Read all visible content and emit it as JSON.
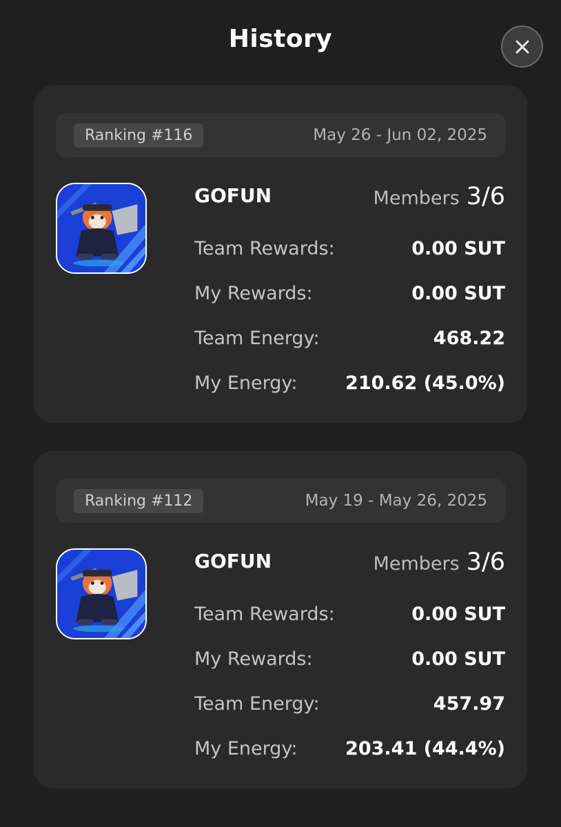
{
  "header": {
    "title": "History",
    "close_icon": "close-icon"
  },
  "colors": {
    "background": "#1f1f1f",
    "card": "#2a2a2a",
    "avatar_blue": "#1a3fd6"
  },
  "history": [
    {
      "ranking": "Ranking #116",
      "date_range": "May 26 - Jun 02, 2025",
      "avatar_icon": "fox-samurai-avatar",
      "team_name": "GOFUN",
      "members_label": "Members",
      "members_value": "3/6",
      "stats": [
        {
          "label": "Team Rewards:",
          "value": "0.00 SUT"
        },
        {
          "label": "My Rewards:",
          "value": "0.00 SUT"
        },
        {
          "label": "Team Energy:",
          "value": "468.22"
        },
        {
          "label": "My Energy:",
          "value": "210.62 (45.0%)"
        }
      ]
    },
    {
      "ranking": "Ranking #112",
      "date_range": "May 19 - May 26, 2025",
      "avatar_icon": "fox-samurai-avatar",
      "team_name": "GOFUN",
      "members_label": "Members",
      "members_value": "3/6",
      "stats": [
        {
          "label": "Team Rewards:",
          "value": "0.00 SUT"
        },
        {
          "label": "My Rewards:",
          "value": "0.00 SUT"
        },
        {
          "label": "Team Energy:",
          "value": "457.97"
        },
        {
          "label": "My Energy:",
          "value": "203.41 (44.4%)"
        }
      ]
    }
  ]
}
